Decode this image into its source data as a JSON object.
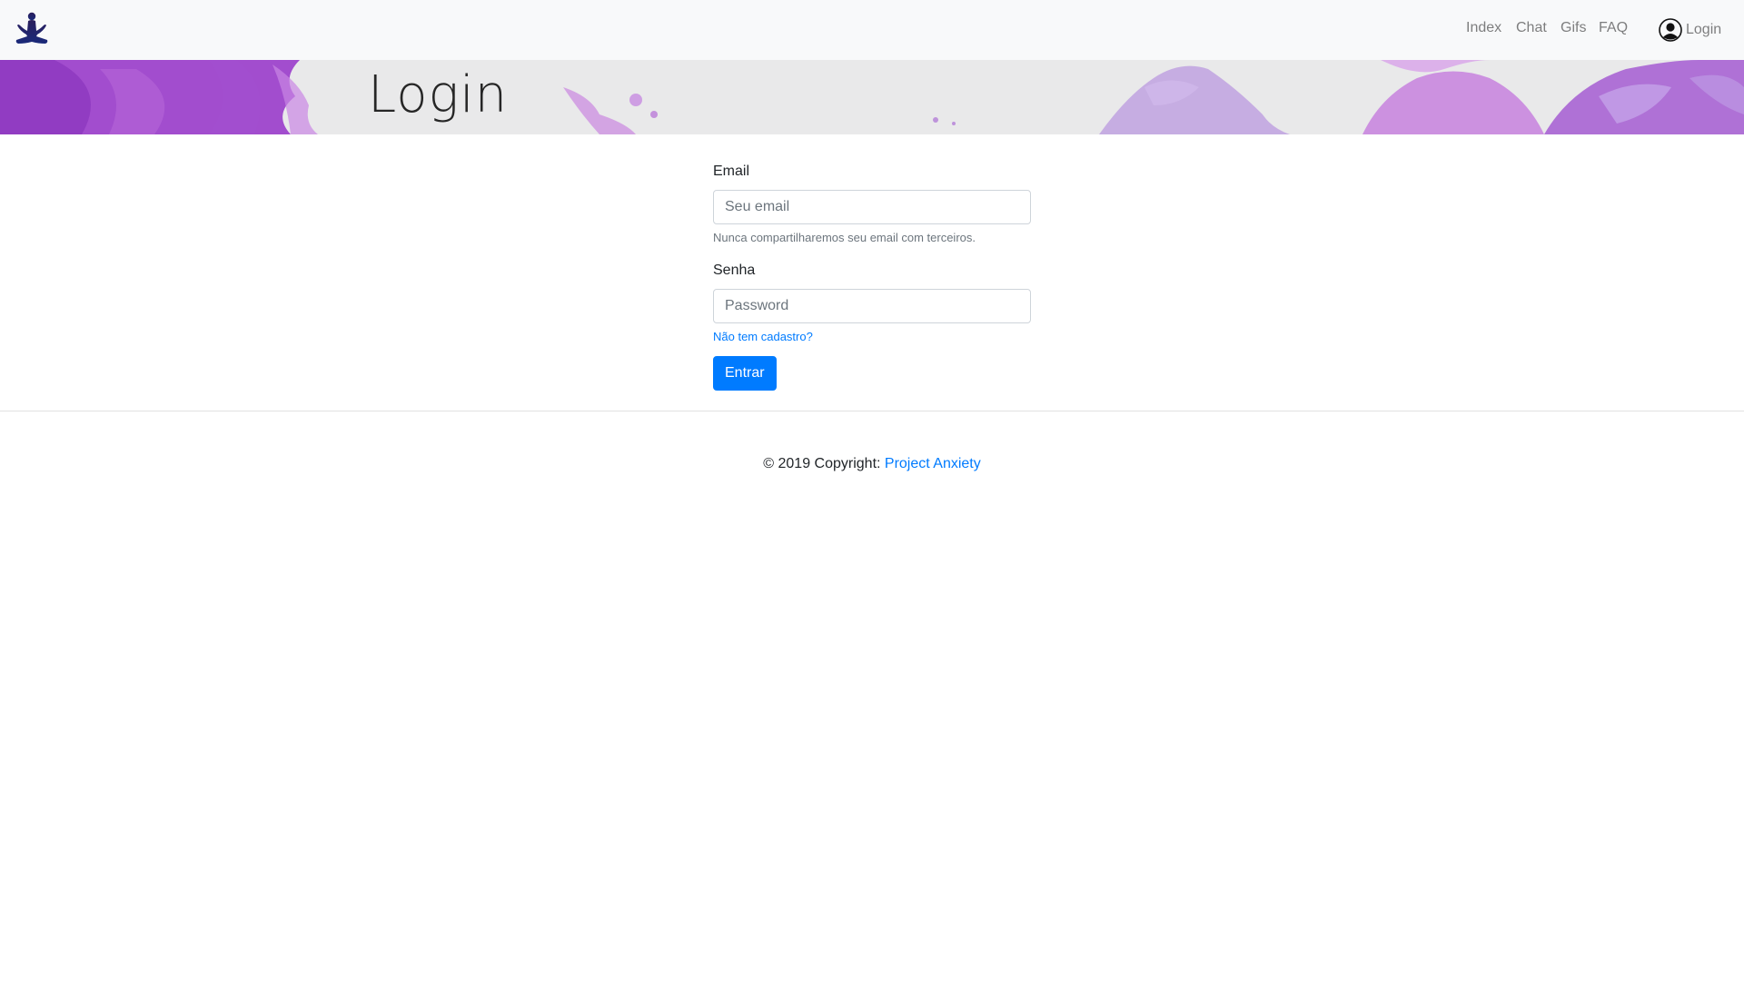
{
  "navbar": {
    "brand_icon": "meditation-figure-icon",
    "links": [
      {
        "label": "Index"
      },
      {
        "label": "Chat"
      },
      {
        "label": "Gifs"
      },
      {
        "label": "FAQ"
      }
    ],
    "login_label": "Login",
    "login_icon": "user-circle-icon"
  },
  "hero": {
    "title": "Login",
    "accent_color": "#9b3fd0"
  },
  "form": {
    "email_label": "Email",
    "email_placeholder": "Seu email",
    "email_help": "Nunca compartilharemos seu email com terceiros.",
    "password_label": "Senha",
    "password_placeholder": "Password",
    "register_link": "Não tem cadastro?",
    "submit_label": "Entrar"
  },
  "footer": {
    "copyright": "© 2019 Copyright: ",
    "brand_link": "Project Anxiety"
  },
  "colors": {
    "primary": "#007bff",
    "navbar_bg": "#f8f9fa",
    "banner_purple": "#9b3fd0"
  }
}
